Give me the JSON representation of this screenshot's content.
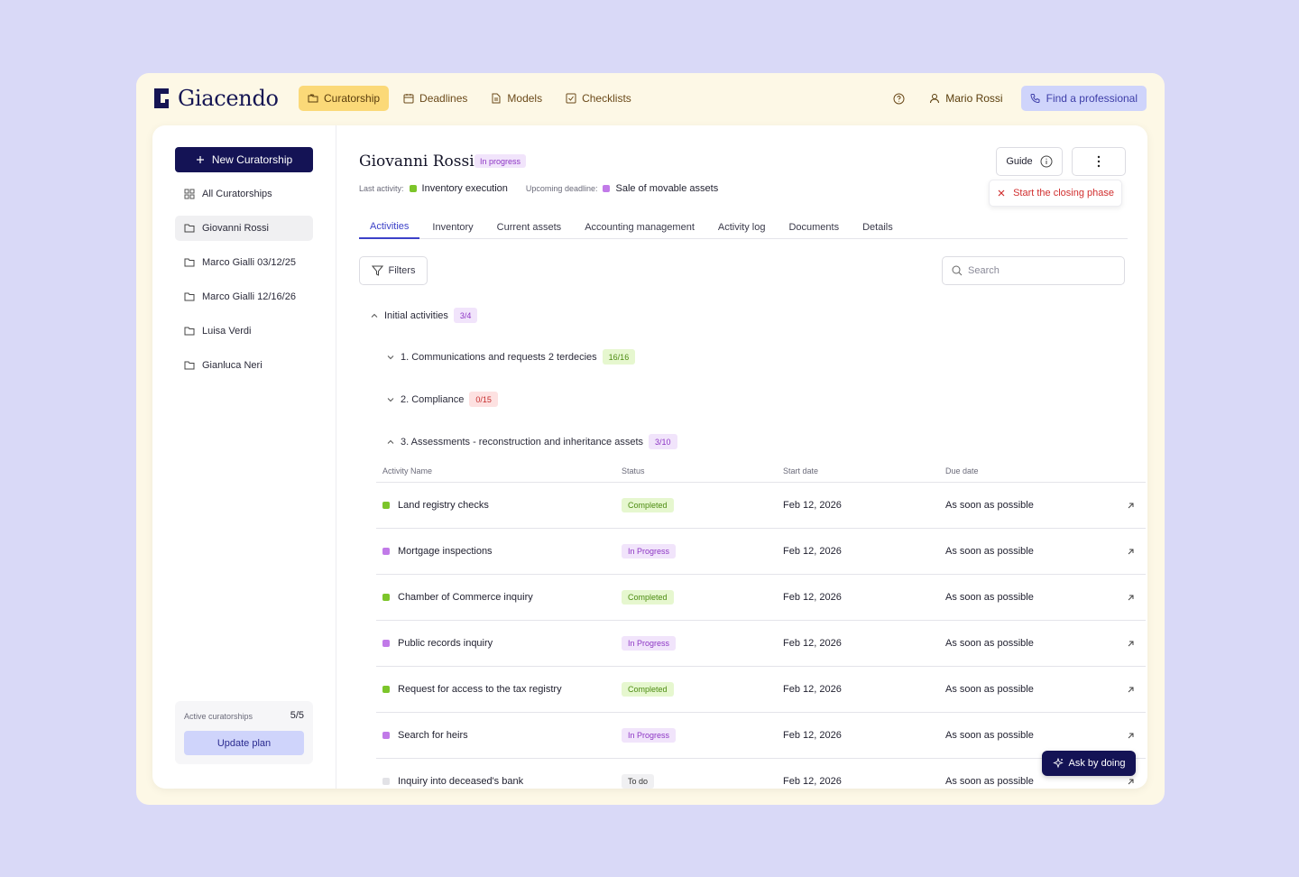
{
  "app": {
    "name": "Giacendo"
  },
  "nav": [
    {
      "label": "Curatorship",
      "icon": "folder-icon",
      "active": true
    },
    {
      "label": "Deadlines",
      "icon": "calendar-icon",
      "active": false
    },
    {
      "label": "Models",
      "icon": "document-icon",
      "active": false
    },
    {
      "label": "Checklists",
      "icon": "checkbox-icon",
      "active": false
    }
  ],
  "header": {
    "user_name": "Mario Rossi",
    "find_professional": "Find a professional"
  },
  "sidebar": {
    "new_button": "New Curatorship",
    "items": [
      {
        "label": "All Curatorships",
        "icon": "grid-icon"
      },
      {
        "label": "Giovanni Rossi",
        "icon": "folder-icon"
      },
      {
        "label": "Marco Gialli 03/12/25",
        "icon": "folder-icon"
      },
      {
        "label": "Marco Gialli 12/16/26",
        "icon": "folder-icon"
      },
      {
        "label": "Luisa Verdi",
        "icon": "folder-icon"
      },
      {
        "label": "Gianluca Neri",
        "icon": "folder-icon"
      }
    ],
    "plan": {
      "label": "Active curatorships",
      "count": "5/5",
      "button": "Update plan"
    }
  },
  "record": {
    "title": "Giovanni Rossi",
    "status": "In progress",
    "last_activity_label": "Last activity:",
    "last_activity_value": "Inventory execution",
    "deadline_label": "Upcoming deadline:",
    "deadline_value": "Sale of movable assets",
    "guide_label": "Guide",
    "closing_label": "Start the closing phase"
  },
  "tabs": [
    "Activities",
    "Inventory",
    "Current assets",
    "Accounting management",
    "Activity log",
    "Documents",
    "Details"
  ],
  "toolbar": {
    "filters_label": "Filters",
    "search_placeholder": "Search"
  },
  "groups": {
    "initial": {
      "label": "Initial activities",
      "count": "3/4"
    },
    "g1": {
      "label": "1. Communications and requests 2 terdecies",
      "count": "16/16"
    },
    "g2": {
      "label": "2. Compliance",
      "count": "0/15"
    },
    "g3": {
      "label": "3. Assessments - reconstruction and inheritance assets",
      "count": "3/10"
    }
  },
  "table": {
    "headers": {
      "name": "Activity Name",
      "status": "Status",
      "start": "Start date",
      "due": "Due date"
    },
    "rows": [
      {
        "name": "Land registry checks",
        "status": "Completed",
        "start": "Feb 12, 2026",
        "due": "As soon as possible"
      },
      {
        "name": "Mortgage inspections",
        "status": "In Progress",
        "start": "Feb 12, 2026",
        "due": "As soon as possible"
      },
      {
        "name": "Chamber of Commerce inquiry",
        "status": "Completed",
        "start": "Feb 12, 2026",
        "due": "As soon as possible"
      },
      {
        "name": "Public records inquiry",
        "status": "In Progress",
        "start": "Feb 12, 2026",
        "due": "As soon as possible"
      },
      {
        "name": "Request for access to the tax registry",
        "status": "Completed",
        "start": "Feb 12, 2026",
        "due": "As soon as possible"
      },
      {
        "name": "Search for heirs",
        "status": "In Progress",
        "start": "Feb 12, 2026",
        "due": "As soon as possible"
      },
      {
        "name": "Inquiry into deceased's bank",
        "status": "To do",
        "start": "Feb 12, 2026",
        "due": "As soon as possible"
      }
    ]
  },
  "assistant": {
    "label": "Ask by doing"
  },
  "colors": {
    "brand": "#141355",
    "accent": "#3c41c8",
    "completed": "#7cc52a",
    "in_progress": "#c17ae8",
    "todo": "#e2e2e6"
  }
}
